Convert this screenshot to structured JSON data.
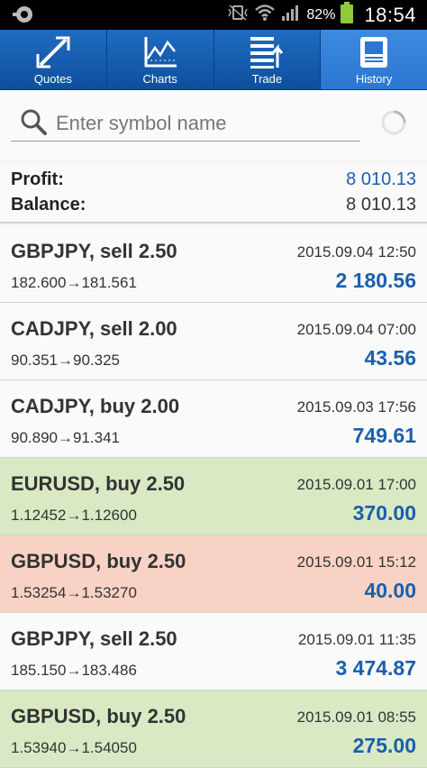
{
  "status_bar": {
    "battery_percent": "82%",
    "time": "18:54"
  },
  "tabs": [
    {
      "label": "Quotes",
      "icon": "quotes-arrows-icon",
      "active": false
    },
    {
      "label": "Charts",
      "icon": "chart-line-icon",
      "active": false
    },
    {
      "label": "Trade",
      "icon": "trade-list-icon",
      "active": false
    },
    {
      "label": "History",
      "icon": "history-tablet-icon",
      "active": true
    }
  ],
  "search": {
    "placeholder": "Enter symbol name",
    "value": ""
  },
  "summary": {
    "profit_label": "Profit:",
    "profit_value": "8 010.13",
    "balance_label": "Balance:",
    "balance_value": "8 010.13"
  },
  "colors": {
    "accent_blue": "#1a5fad",
    "tab_bar": "#1a62b5",
    "row_green": "#d9e9c4",
    "row_red": "#f8d2c4"
  },
  "deals": [
    {
      "title": "GBPJPY, sell 2.50",
      "time": "2015.09.04 12:50",
      "prices": "182.600→181.561",
      "profit": "2 180.56",
      "highlight": "none"
    },
    {
      "title": "CADJPY, sell 2.00",
      "time": "2015.09.04 07:00",
      "prices": "90.351→90.325",
      "profit": "43.56",
      "highlight": "none"
    },
    {
      "title": "CADJPY, buy 2.00",
      "time": "2015.09.03 17:56",
      "prices": "90.890→91.341",
      "profit": "749.61",
      "highlight": "none"
    },
    {
      "title": "EURUSD, buy 2.50",
      "time": "2015.09.01 17:00",
      "prices": "1.12452→1.12600",
      "profit": "370.00",
      "highlight": "green"
    },
    {
      "title": "GBPUSD, buy 2.50",
      "time": "2015.09.01 15:12",
      "prices": "1.53254→1.53270",
      "profit": "40.00",
      "highlight": "red"
    },
    {
      "title": "GBPJPY, sell 2.50",
      "time": "2015.09.01 11:35",
      "prices": "185.150→183.486",
      "profit": "3 474.87",
      "highlight": "none"
    },
    {
      "title": "GBPUSD, buy 2.50",
      "time": "2015.09.01 08:55",
      "prices": "1.53940→1.54050",
      "profit": "275.00",
      "highlight": "green"
    }
  ]
}
